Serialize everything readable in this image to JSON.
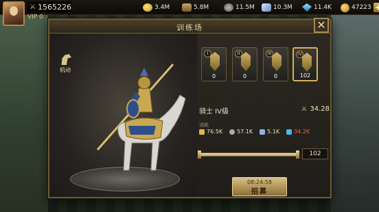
{
  "topbar": {
    "power": "1565226",
    "vip": "VIP 0",
    "resources": [
      {
        "icon": "food-icon",
        "value": "3.4M"
      },
      {
        "icon": "wood-icon",
        "value": "5.8M"
      },
      {
        "icon": "stone-icon",
        "value": "11.5M"
      },
      {
        "icon": "iron-icon",
        "value": "10.3M"
      },
      {
        "icon": "crystal-icon",
        "value": "11.4K"
      }
    ],
    "gold": "47223"
  },
  "modal": {
    "title": "训练场",
    "close": "✕",
    "side_tab_label": "机动"
  },
  "tiers": [
    {
      "badge": "I",
      "count": "0"
    },
    {
      "badge": "II",
      "count": "0"
    },
    {
      "badge": "III",
      "count": "0"
    },
    {
      "badge": "IV",
      "count": "102"
    }
  ],
  "unit": {
    "name": "骑士 IV级",
    "power": "34.28",
    "cost_label": "消耗",
    "costs": [
      {
        "icon": "food-icon",
        "value": "76.5K",
        "lack": false
      },
      {
        "icon": "stone-icon",
        "value": "57.1K",
        "lack": false
      },
      {
        "icon": "iron-icon",
        "value": "5.1K",
        "lack": false
      },
      {
        "icon": "crystal-icon",
        "value": "34.2K",
        "lack": true
      }
    ],
    "quantity": "102",
    "slider_fraction": 1.0,
    "timer": "08:24:58",
    "recruit_label": "招募"
  },
  "colors": {
    "accent_gold": "#d6b35a",
    "shortage_red": "#ff5a48"
  }
}
